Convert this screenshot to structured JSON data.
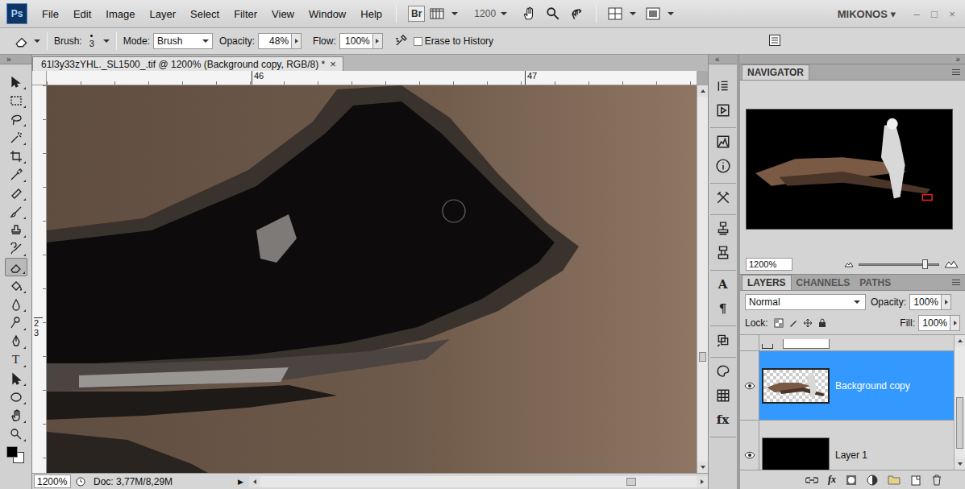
{
  "app": {
    "logo": "Ps",
    "bridge": "Br",
    "zoom": "1200",
    "workspace": "MIKONOS ▾",
    "window_controls": [
      "–",
      "□",
      "×"
    ]
  },
  "menu": [
    "File",
    "Edit",
    "Image",
    "Layer",
    "Select",
    "Filter",
    "View",
    "Window",
    "Help"
  ],
  "options": {
    "brush_label": "Brush:",
    "brush_size": "3",
    "mode_label": "Mode:",
    "mode": "Brush",
    "opacity_label": "Opacity:",
    "opacity": "48%",
    "flow_label": "Flow:",
    "flow": "100%",
    "erase_to_history": {
      "label": "Erase to History",
      "checked": false
    }
  },
  "toolbox": {
    "collapse": "»",
    "tools": [
      {
        "kind": "icon",
        "selected": false
      },
      {
        "kind": "icon",
        "selected": false
      },
      {
        "kind": "icon",
        "selected": false
      },
      {
        "kind": "icon",
        "selected": false
      },
      {
        "kind": "icon",
        "selected": false
      },
      {
        "kind": "icon",
        "selected": false
      },
      {
        "kind": "icon",
        "selected": false
      },
      {
        "kind": "icon",
        "selected": false
      },
      {
        "kind": "icon",
        "selected": false
      },
      {
        "kind": "icon",
        "selected": false
      },
      {
        "kind": "icon",
        "selected": true
      },
      {
        "kind": "icon",
        "selected": false
      },
      {
        "kind": "icon",
        "selected": false
      },
      {
        "kind": "icon",
        "selected": false
      },
      {
        "kind": "icon",
        "selected": false
      },
      {
        "kind": "glyph",
        "glyph": "T",
        "selected": false
      },
      {
        "kind": "icon",
        "selected": false
      },
      {
        "kind": "icon",
        "selected": false
      },
      {
        "kind": "icon",
        "selected": false
      },
      {
        "kind": "icon",
        "selected": false
      }
    ]
  },
  "document": {
    "tab": {
      "title": "61l3y33zYHL._SL1500_.tif @ 1200% (Background copy, RGB/8) *",
      "close": "×"
    },
    "ruler_top": [
      "46",
      "47"
    ],
    "ruler_left": "23",
    "zoom": "1200%",
    "doc_info": "Doc: 3,77M/8,29M",
    "status_arrow": "▶",
    "scroll_h": 0.84,
    "scroll_v": 0.7
  },
  "dock": {
    "collapse": "«",
    "groups": [
      [
        {
          "kind": "icon"
        },
        {
          "kind": "icon"
        }
      ],
      [
        {
          "kind": "icon"
        },
        {
          "kind": "icon"
        }
      ],
      [
        {
          "kind": "icon"
        }
      ],
      [
        {
          "kind": "icon"
        },
        {
          "kind": "icon"
        }
      ],
      [
        {
          "kind": "glyph",
          "glyph": "A"
        },
        {
          "kind": "glyph",
          "glyph": "¶"
        }
      ],
      [
        {
          "kind": "icon"
        }
      ],
      [
        {
          "kind": "icon"
        },
        {
          "kind": "icon"
        },
        {
          "kind": "glyph",
          "glyph": "fx"
        }
      ]
    ]
  },
  "navigator": {
    "collapse": "»",
    "title": "NAVIGATOR",
    "zoom": "1200%",
    "level": 0.8
  },
  "layers_panel": {
    "tabs": [
      {
        "label": "LAYERS",
        "selected": true
      },
      {
        "label": "CHANNELS",
        "selected": false
      },
      {
        "label": "PATHS",
        "selected": false
      }
    ],
    "blend_mode": "Normal",
    "opacity_label": "Opacity:",
    "opacity": "100%",
    "lock_label": "Lock:",
    "fill_label": "Fill:",
    "fill": "100%",
    "layers": [
      {
        "name": "",
        "kind": "clipped",
        "visible": false,
        "selected": false
      },
      {
        "name": "Background copy",
        "kind": "image",
        "visible": true,
        "selected": true
      },
      {
        "name": "Layer 1",
        "kind": "solid",
        "visible": true,
        "selected": false
      }
    ],
    "scroll": 0.45,
    "footer_fx": "fx"
  }
}
